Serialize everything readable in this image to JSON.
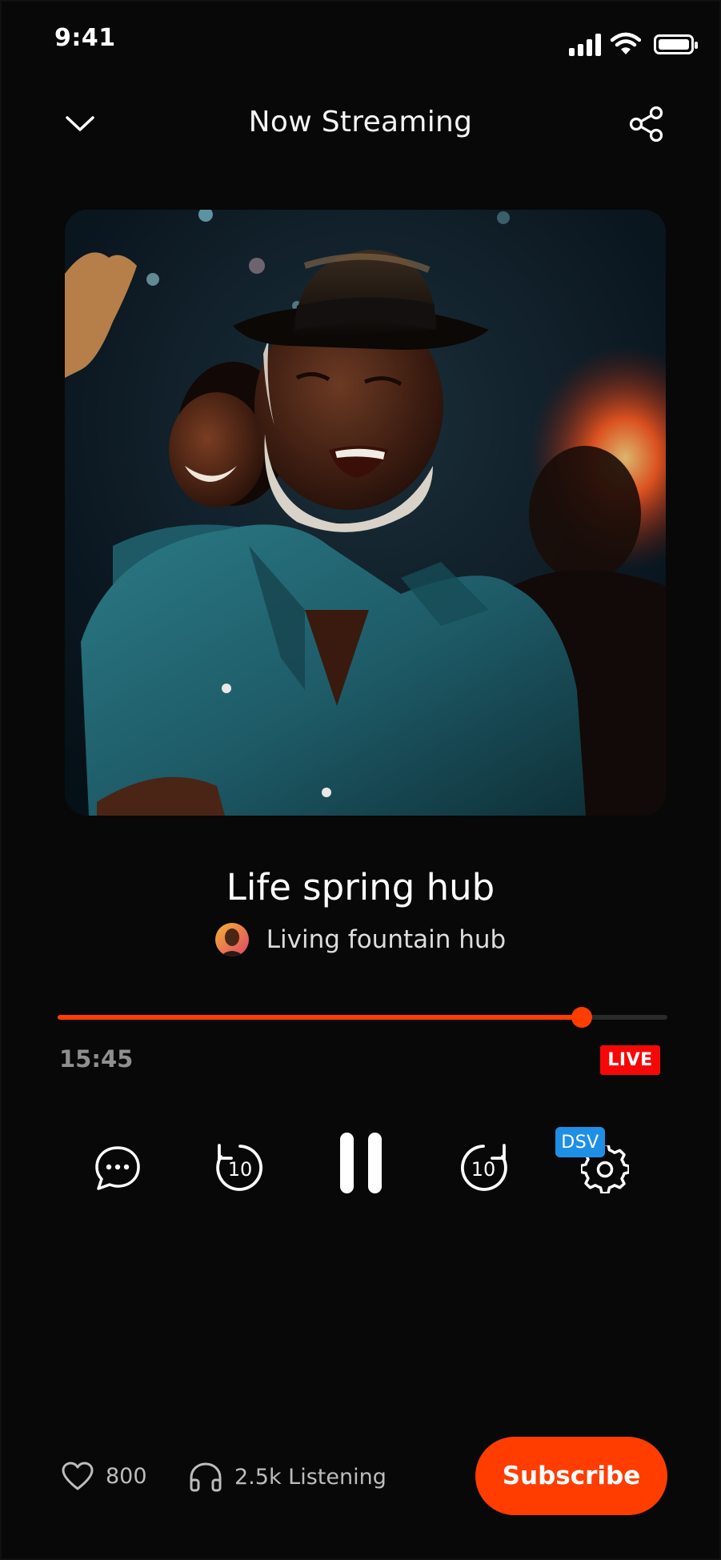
{
  "status_bar": {
    "time": "9:41",
    "icons": [
      "signal-icon",
      "wifi-icon",
      "battery-icon"
    ]
  },
  "header": {
    "title": "Now Streaming",
    "left_icon": "chevron-down-icon",
    "right_icon": "share-icon"
  },
  "artwork": {
    "description": "album-artwork"
  },
  "track": {
    "title": "Life spring hub",
    "artist": "Living fountain hub"
  },
  "playback": {
    "elapsed": "15:45",
    "progress_fraction": 0.86,
    "live_label": "LIVE"
  },
  "controls": {
    "chat_icon": "chat-icon",
    "rewind_label": "10",
    "forward_label": "10",
    "pause_icon": "pause-icon",
    "settings_icon": "gear-icon",
    "settings_badge": "DSV"
  },
  "footer": {
    "likes": "800",
    "listeners": "2.5k Listening",
    "subscribe_label": "Subscribe"
  },
  "colors": {
    "accent": "#ff3d00",
    "live": "#f70808",
    "badge": "#1f8fe6",
    "background": "#080808"
  }
}
